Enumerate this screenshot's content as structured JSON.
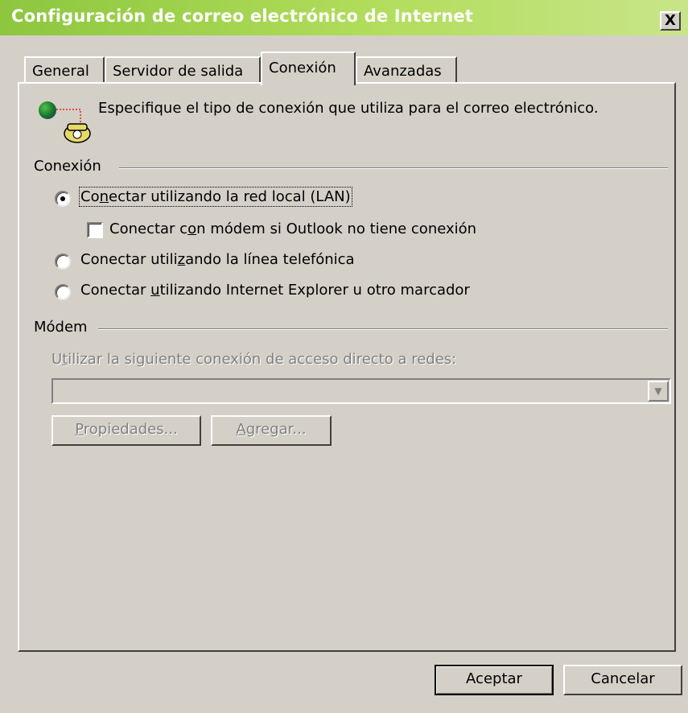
{
  "window": {
    "title": "Configuración de correo electrónico de Internet",
    "close_label": "X"
  },
  "tabs": [
    {
      "label": "General"
    },
    {
      "label": "Servidor de salida"
    },
    {
      "label": "Conexión",
      "active": true
    },
    {
      "label": "Avanzadas"
    }
  ],
  "intro": {
    "text": "Especifique el tipo de conexión que utiliza para el correo electrónico.",
    "icon": "globe-phone-icon"
  },
  "connection_group": {
    "label": "Conexión",
    "lan": {
      "pre": "Co",
      "accel": "n",
      "post": "ectar utilizando la red local (LAN)",
      "selected": true
    },
    "modem_fallback": {
      "pre": "Conectar c",
      "accel": "o",
      "post": "n módem si Outlook no tiene conexión",
      "checked": false
    },
    "phone": {
      "pre": "Conectar utili",
      "accel": "z",
      "post": "ando la línea telefónica",
      "selected": false
    },
    "ie": {
      "pre": "Conectar ",
      "accel": "u",
      "post": "tilizando Internet Explorer u otro marcador",
      "selected": false
    }
  },
  "modem_group": {
    "label": "Módem",
    "dialup_label": {
      "pre": "U",
      "accel": "t",
      "post": "ilizar la siguiente conexión de acceso directo a redes:"
    },
    "dialup_value": "",
    "properties_button": {
      "accel": "P",
      "post": "ropiedades..."
    },
    "add_button": {
      "accel": "A",
      "post": "gregar..."
    }
  },
  "footer": {
    "ok_label": "Aceptar",
    "cancel_label": "Cancelar"
  }
}
